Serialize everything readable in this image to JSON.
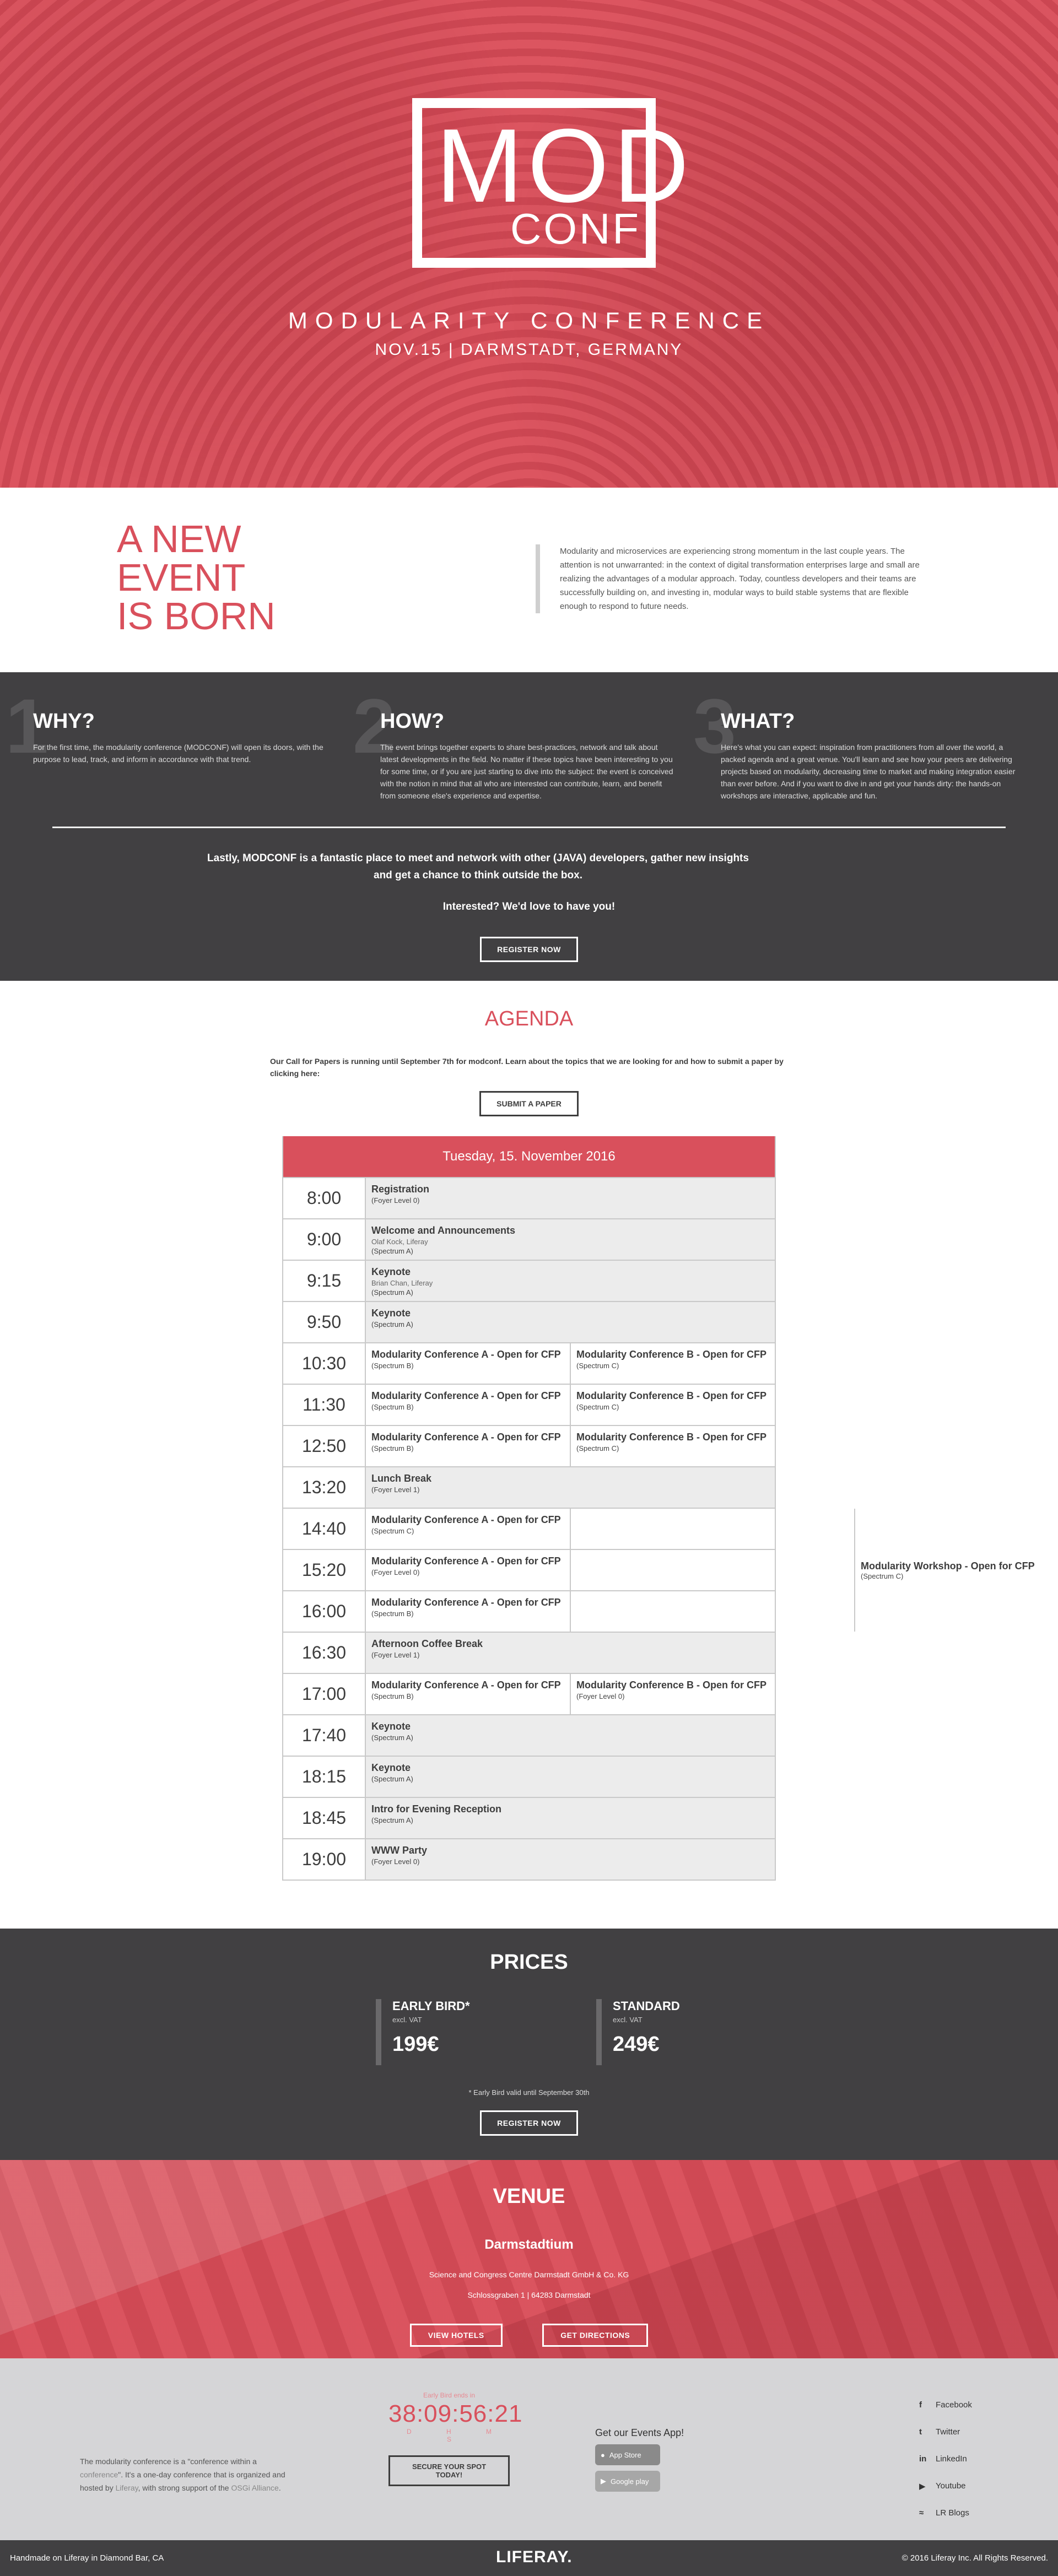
{
  "hero": {
    "logo_top": "MOD",
    "logo_bottom": "CONF",
    "title": "MODULARITY CONFERENCE",
    "subtitle": "NOV.15 | DARMSTADT, GERMANY"
  },
  "intro": {
    "heading_lines": [
      "A NEW",
      "EVENT",
      "IS BORN"
    ],
    "quote": "Modularity and microservices are experiencing strong momentum in the last couple years. The attention is not unwarranted: in the context of digital transformation enterprises large and small are realizing the advantages of a modular approach. Today, countless developers and their teams are successfully building on, and investing in, modular ways to build stable systems that are flexible enough to respond to future needs."
  },
  "why": {
    "columns": [
      {
        "num": "1",
        "title": "WHY?",
        "text": "For the first time, the modularity conference (MODCONF) will open its doors, with the purpose to lead, track, and inform in accordance with that trend."
      },
      {
        "num": "2",
        "title": "HOW?",
        "text": "The event brings together experts to share best-practices, network and talk about latest developments in the field. No matter if these topics have been interesting to you for some time, or if you are just starting to dive into the subject: the event is conceived with the notion in mind that all who are interested can contribute, learn, and benefit from someone else's experience and expertise."
      },
      {
        "num": "3",
        "title": "WHAT?",
        "text": "Here's what you can expect: inspiration from practitioners from all over the world, a packed agenda and a great venue. You'll learn and see how your peers are delivering projects based on modularity, decreasing time to market and making integration easier than ever before. And if you want to dive in and get your hands dirty: the hands-on workshops are interactive, applicable and fun."
      }
    ],
    "lastly": "Lastly, MODCONF is a fantastic place to meet and network with other (JAVA) developers, gather new insights and get a chance to think outside the box.",
    "interested": "Interested? We'd love to have you!",
    "register_label": "REGISTER NOW"
  },
  "agenda": {
    "title": "AGENDA",
    "cfp": "Our Call for Papers is running until September 7th for modconf. Learn about the topics that we are looking for and how to submit a paper by clicking here:",
    "submit_label": "SUBMIT A PAPER",
    "date": "Tuesday, 15. November 2016",
    "rows": [
      {
        "time": "8:00",
        "cells": [
          {
            "t": "Registration",
            "r": "(Foyer Level 0)"
          }
        ]
      },
      {
        "time": "9:00",
        "cells": [
          {
            "t": "Welcome and Announcements",
            "s": "Olaf Kock, Liferay",
            "r": "(Spectrum A)"
          }
        ]
      },
      {
        "time": "9:15",
        "cells": [
          {
            "t": "Keynote",
            "s": "Brian Chan, Liferay",
            "r": "(Spectrum A)"
          }
        ]
      },
      {
        "time": "9:50",
        "cells": [
          {
            "t": "Keynote",
            "r": "(Spectrum A)"
          }
        ]
      },
      {
        "time": "10:30",
        "cells": [
          {
            "t": "Modularity Conference A - Open for CFP",
            "r": "(Spectrum B)",
            "w": true
          },
          {
            "t": "Modularity Conference B - Open for CFP",
            "r": "(Spectrum C)",
            "w": true
          }
        ]
      },
      {
        "time": "11:30",
        "cells": [
          {
            "t": "Modularity Conference A - Open for CFP",
            "r": "(Spectrum B)",
            "w": true
          },
          {
            "t": "Modularity Conference B - Open for CFP",
            "r": "(Spectrum C)",
            "w": true
          }
        ]
      },
      {
        "time": "12:50",
        "cells": [
          {
            "t": "Modularity Conference A - Open for CFP",
            "r": "(Spectrum B)",
            "w": true
          },
          {
            "t": "Modularity Conference B - Open for CFP",
            "r": "(Spectrum C)",
            "w": true
          }
        ]
      },
      {
        "time": "13:20",
        "cells": [
          {
            "t": "Lunch Break",
            "r": "(Foyer Level 1)"
          }
        ]
      },
      {
        "time": "14:40",
        "cells": [
          {
            "t": "Modularity Conference A - Open for CFP",
            "r": "(Spectrum C)",
            "w": true
          }
        ],
        "ws": true
      },
      {
        "time": "15:20",
        "cells": [
          {
            "t": "Modularity Conference A - Open for CFP",
            "r": "(Foyer Level 0)",
            "w": true
          }
        ],
        "ws": true
      },
      {
        "time": "16:00",
        "cells": [
          {
            "t": "Modularity Conference A - Open for CFP",
            "r": "(Spectrum B)",
            "w": true
          }
        ],
        "ws": true
      },
      {
        "time": "16:30",
        "cells": [
          {
            "t": "Afternoon Coffee Break",
            "r": "(Foyer Level 1)"
          }
        ]
      },
      {
        "time": "17:00",
        "cells": [
          {
            "t": "Modularity Conference A - Open for CFP",
            "r": "(Spectrum B)",
            "w": true
          },
          {
            "t": "Modularity Conference B - Open for CFP",
            "r": "(Foyer Level 0)",
            "w": true
          }
        ]
      },
      {
        "time": "17:40",
        "cells": [
          {
            "t": "Keynote",
            "r": "(Spectrum A)"
          }
        ]
      },
      {
        "time": "18:15",
        "cells": [
          {
            "t": "Keynote",
            "r": "(Spectrum A)"
          }
        ]
      },
      {
        "time": "18:45",
        "cells": [
          {
            "t": "Intro for Evening Reception",
            "r": "(Spectrum A)"
          }
        ]
      },
      {
        "time": "19:00",
        "cells": [
          {
            "t": "WWW Party",
            "r": "(Foyer Level 0)"
          }
        ]
      }
    ],
    "workshop": {
      "t": "Modularity Workshop - Open for CFP",
      "r": "(Spectrum C)"
    }
  },
  "prices": {
    "title": "PRICES",
    "items": [
      {
        "name": "EARLY BIRD*",
        "vat": "excl. VAT",
        "price": "199€"
      },
      {
        "name": "STANDARD",
        "vat": "excl. VAT",
        "price": "249€"
      }
    ],
    "note": "* Early Bird valid until September 30th",
    "register_label": "REGISTER NOW"
  },
  "venue": {
    "title": "VENUE",
    "place": "Darmstadtium",
    "addr1": "Science and Congress Centre Darmstadt GmbH & Co. KG",
    "addr2": "Schlossgraben 1 | 64283 Darmstadt",
    "hotels_label": "VIEW HOTELS",
    "directions_label": "GET DIRECTIONS"
  },
  "footer": {
    "about_pre": "The modularity conference is a \"conference within a ",
    "about_link1": "conference",
    "about_mid": "\". It's a one-day conference that is organized and hosted by ",
    "about_link2": "Liferay",
    "about_mid2": ", with strong support of the ",
    "about_link3": "OSGi Alliance",
    "about_end": ".",
    "countdown_label": "Early Bird ends in",
    "countdown": "38:09:56:21",
    "units": "D H M S",
    "secure_label": "SECURE YOUR SPOT TODAY!",
    "app_heading": "Get our Events App!",
    "app_store": "App Store",
    "google_play": "Google play",
    "social": [
      {
        "icon": "f",
        "label": "Facebook"
      },
      {
        "icon": "t",
        "label": "Twitter"
      },
      {
        "icon": "in",
        "label": "LinkedIn"
      },
      {
        "icon": "▶",
        "label": "Youtube"
      },
      {
        "icon": "≈",
        "label": "LR Blogs"
      }
    ],
    "bottom_left": "Handmade on Liferay in Diamond Bar, CA",
    "bottom_logo": "LIFERAY.",
    "bottom_right": "© 2016 Liferay Inc. All Rights Reserved."
  }
}
